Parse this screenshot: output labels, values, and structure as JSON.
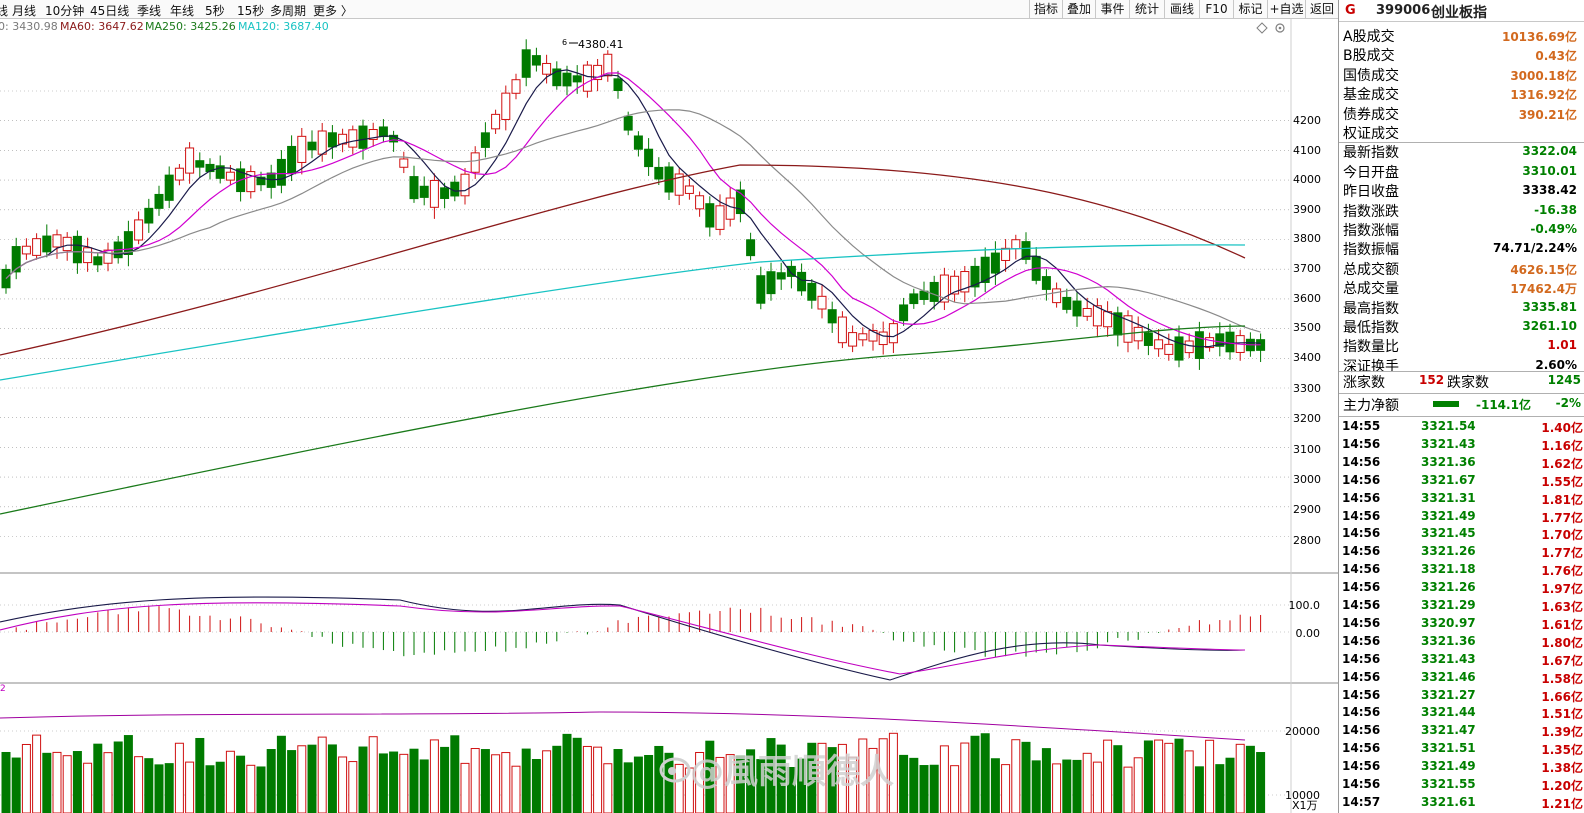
{
  "toolbar": {
    "periods": [
      "线",
      "月线",
      "10分钟",
      "45日线",
      "季线",
      "年线",
      "5秒",
      "15秒",
      "多周期",
      "更多 〉"
    ],
    "buttons": [
      "指标",
      "叠加",
      "事件",
      "统计",
      "画线",
      "F10",
      "标记",
      "+自选",
      "返回"
    ]
  },
  "ma_legend": [
    {
      "text": "0: 3430.98",
      "color": "#7a7a7a"
    },
    {
      "text": "MA60: 3647.62",
      "color": "#8b1a1a"
    },
    {
      "text": "MA250: 3425.26",
      "color": "#1a7a1a"
    },
    {
      "text": "MA120: 3687.40",
      "color": "#19c3c3"
    }
  ],
  "chart": {
    "high_label": "4380.41",
    "high_marker": "6",
    "price_axis": [
      "4200",
      "4100",
      "4000",
      "3900",
      "3800",
      "3700",
      "3600",
      "3500",
      "3400",
      "3300",
      "3200",
      "3100",
      "3000",
      "2900",
      "2800"
    ],
    "macd_axis": [
      "100.0",
      "0.00"
    ],
    "volume_axis": [
      "20000",
      "10000"
    ],
    "volume_unit": "X1万",
    "volume_mark": "2",
    "watermark": "@風雨順德人",
    "icons": [
      "diamond-icon",
      "settings-icon"
    ]
  },
  "side": {
    "badge": "G",
    "code": "399006",
    "name": "创业板指",
    "stats": [
      {
        "label": "A股成交",
        "value": "10136.69亿",
        "color": "#d2691e"
      },
      {
        "label": "B股成交",
        "value": "0.43亿",
        "color": "#d2691e"
      },
      {
        "label": "国债成交",
        "value": "3000.18亿",
        "color": "#d2691e"
      },
      {
        "label": "基金成交",
        "value": "1316.92亿",
        "color": "#d2691e"
      },
      {
        "label": "债券成交",
        "value": "390.21亿",
        "color": "#d2691e"
      },
      {
        "label": "权证成交",
        "value": "",
        "color": "#d2691e"
      },
      {
        "label": "最新指数",
        "value": "3322.04",
        "color": "#008000"
      },
      {
        "label": "今日开盘",
        "value": "3310.01",
        "color": "#008000"
      },
      {
        "label": "昨日收盘",
        "value": "3338.42",
        "color": "#000000"
      },
      {
        "label": "指数涨跌",
        "value": "-16.38",
        "color": "#008000"
      },
      {
        "label": "指数涨幅",
        "value": "-0.49%",
        "color": "#008000"
      },
      {
        "label": "指数振幅",
        "value": "74.71/2.24%",
        "color": "#000000"
      },
      {
        "label": "总成交额",
        "value": "4626.15亿",
        "color": "#d2691e"
      },
      {
        "label": "总成交量",
        "value": "17462.4万",
        "color": "#d2691e"
      },
      {
        "label": "最高指数",
        "value": "3335.81",
        "color": "#008000"
      },
      {
        "label": "最低指数",
        "value": "3261.10",
        "color": "#008000"
      },
      {
        "label": "指数量比",
        "value": "1.01",
        "color": "#c80000"
      },
      {
        "label": "深证换手",
        "value": "2.60%",
        "color": "#000000"
      }
    ],
    "breadth": {
      "up_label": "涨家数",
      "up_value": "152",
      "down_label": "跌家数",
      "down_value": "1245"
    },
    "net_flow": {
      "label": "主力净额",
      "value": "-114.1亿",
      "pct": "-2%"
    },
    "ticks": [
      {
        "time": "14:55",
        "price": "3321.54",
        "amount": "1.40亿"
      },
      {
        "time": "14:56",
        "price": "3321.43",
        "amount": "1.16亿"
      },
      {
        "time": "14:56",
        "price": "3321.36",
        "amount": "1.62亿"
      },
      {
        "time": "14:56",
        "price": "3321.67",
        "amount": "1.55亿"
      },
      {
        "time": "14:56",
        "price": "3321.31",
        "amount": "1.81亿"
      },
      {
        "time": "14:56",
        "price": "3321.49",
        "amount": "1.77亿"
      },
      {
        "time": "14:56",
        "price": "3321.45",
        "amount": "1.70亿"
      },
      {
        "time": "14:56",
        "price": "3321.26",
        "amount": "1.77亿"
      },
      {
        "time": "14:56",
        "price": "3321.18",
        "amount": "1.76亿"
      },
      {
        "time": "14:56",
        "price": "3321.26",
        "amount": "1.97亿"
      },
      {
        "time": "14:56",
        "price": "3321.29",
        "amount": "1.63亿"
      },
      {
        "time": "14:56",
        "price": "3320.97",
        "amount": "1.61亿"
      },
      {
        "time": "14:56",
        "price": "3321.36",
        "amount": "1.80亿"
      },
      {
        "time": "14:56",
        "price": "3321.43",
        "amount": "1.67亿"
      },
      {
        "time": "14:56",
        "price": "3321.46",
        "amount": "1.58亿"
      },
      {
        "time": "14:56",
        "price": "3321.27",
        "amount": "1.66亿"
      },
      {
        "time": "14:56",
        "price": "3321.44",
        "amount": "1.51亿"
      },
      {
        "time": "14:56",
        "price": "3321.47",
        "amount": "1.39亿"
      },
      {
        "time": "14:56",
        "price": "3321.51",
        "amount": "1.35亿"
      },
      {
        "time": "14:56",
        "price": "3321.49",
        "amount": "1.38亿"
      },
      {
        "time": "14:56",
        "price": "3321.55",
        "amount": "1.20亿"
      },
      {
        "time": "14:57",
        "price": "3321.61",
        "amount": "1.21亿"
      }
    ]
  }
}
